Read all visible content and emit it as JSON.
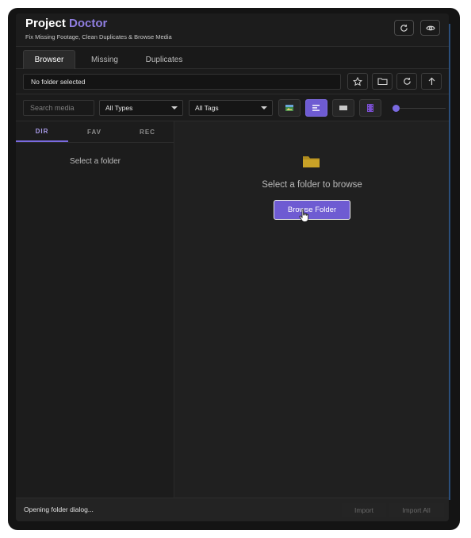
{
  "header": {
    "title_part1": "Project",
    "title_part2": "Doctor",
    "subtitle": "Fix Missing Footage, Clean Duplicates & Browse Media",
    "buttons": [
      {
        "icon": "refresh-icon"
      },
      {
        "icon": "settings-eye-icon"
      }
    ]
  },
  "tabs": [
    {
      "label": "Browser",
      "active": true
    },
    {
      "label": "Missing",
      "active": false
    },
    {
      "label": "Duplicates",
      "active": false
    }
  ],
  "path": {
    "value": "No folder selected",
    "buttons": [
      "star-icon",
      "folder-open-icon",
      "refresh-icon",
      "arrow-up-icon"
    ]
  },
  "filters": {
    "search_placeholder": "Search media",
    "type_select": "All Types",
    "tag_select": "All Tags",
    "view_buttons": [
      {
        "icon": "image-icon",
        "active": false
      },
      {
        "icon": "list-icon",
        "active": true
      },
      {
        "icon": "grid-icon",
        "active": false
      },
      {
        "icon": "film-icon",
        "active": false
      }
    ],
    "zoom_level": 0
  },
  "sidebar": {
    "tabs": [
      {
        "label": "DIR",
        "active": true
      },
      {
        "label": "FAV",
        "active": false
      },
      {
        "label": "REC",
        "active": false
      }
    ],
    "empty_text": "Select a folder"
  },
  "main": {
    "empty_text": "Select a folder to browse",
    "browse_label": "Browse Folder"
  },
  "statusbar": {
    "status": "Opening folder dialog...",
    "import_label": "Import",
    "import_all_label": "Import All"
  },
  "colors": {
    "accent": "#6e5bd2",
    "folder": "#c9a227",
    "background": "#1e1e1e"
  }
}
